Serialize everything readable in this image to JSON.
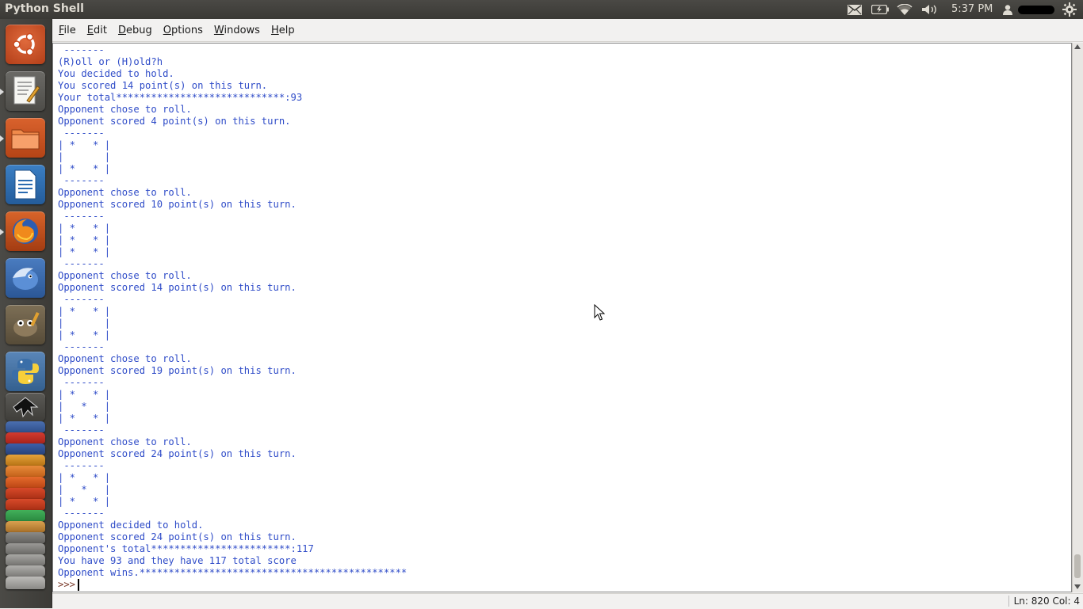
{
  "window": {
    "title": "Python Shell",
    "clock": "5:37 PM"
  },
  "panel": {
    "indicators": [
      "mail-icon",
      "battery-icon",
      "wifi-icon",
      "volume-icon",
      "user-icon",
      "session-gear-icon"
    ]
  },
  "menu": {
    "items": [
      "File",
      "Edit",
      "Debug",
      "Options",
      "Windows",
      "Help"
    ]
  },
  "launcher": {
    "apps": [
      "ubuntu-dash-icon",
      "text-editor-icon",
      "files-icon",
      "libreoffice-writer-icon",
      "firefox-icon",
      "thunderbird-icon",
      "gimp-icon",
      "python-icon",
      "inkscape-icon"
    ],
    "stacked": [
      "qbittorrent-icon",
      "filezilla-icon",
      "calendar-icon",
      "photo-icon",
      "ubuntu-one-icon",
      "game-icon",
      "qtcreator-icon",
      "disk-icon",
      "misc-icon"
    ]
  },
  "shell": {
    "lines": [
      " -------",
      "(R)oll or (H)old?h",
      "You decided to hold.",
      "You scored 14 point(s) on this turn.",
      "Your total*****************************:93",
      "Opponent chose to roll.",
      "Opponent scored 4 point(s) on this turn.",
      " -------",
      "| *   * |",
      "|       |",
      "| *   * |",
      " -------",
      "Opponent chose to roll.",
      "Opponent scored 10 point(s) on this turn.",
      " -------",
      "| *   * |",
      "| *   * |",
      "| *   * |",
      " -------",
      "Opponent chose to roll.",
      "Opponent scored 14 point(s) on this turn.",
      " -------",
      "| *   * |",
      "|       |",
      "| *   * |",
      " -------",
      "Opponent chose to roll.",
      "Opponent scored 19 point(s) on this turn.",
      " -------",
      "| *   * |",
      "|   *   |",
      "| *   * |",
      " -------",
      "Opponent chose to roll.",
      "Opponent scored 24 point(s) on this turn.",
      " -------",
      "| *   * |",
      "|   *   |",
      "| *   * |",
      " -------",
      "Opponent decided to hold.",
      "Opponent scored 24 point(s) on this turn.",
      "Opponent's total************************:117",
      "You have 93 and they have 117 total score",
      "Opponent wins.**********************************************"
    ],
    "prompt": ">>>"
  },
  "status": {
    "position": "Ln: 820  Col: 4"
  },
  "colors": {
    "output": "#2f4cc8",
    "prompt": "#7a3a2a"
  }
}
